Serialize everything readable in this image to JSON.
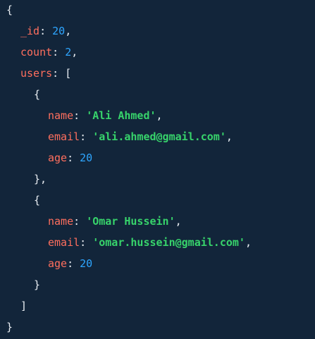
{
  "document": {
    "open_brace": "{",
    "close_brace": "}",
    "id_key": "_id",
    "id_value": "20",
    "count_key": "count",
    "count_value": "2",
    "users_key": "users",
    "array_open": "[",
    "array_close": "]",
    "users": [
      {
        "name_key": "name",
        "name_value": "'Ali Ahmed'",
        "email_key": "email",
        "email_value": "'ali.ahmed@gmail.com'",
        "age_key": "age",
        "age_value": "20"
      },
      {
        "name_key": "name",
        "name_value": "'Omar Hussein'",
        "email_key": "email",
        "email_value": "'omar.hussein@gmail.com'",
        "age_key": "age",
        "age_value": "20"
      }
    ]
  },
  "colors": {
    "background": "#12253a",
    "key": "#ff6f5e",
    "string": "#37d36b",
    "number": "#2ea6ff",
    "punctuation": "#e8edf2"
  }
}
